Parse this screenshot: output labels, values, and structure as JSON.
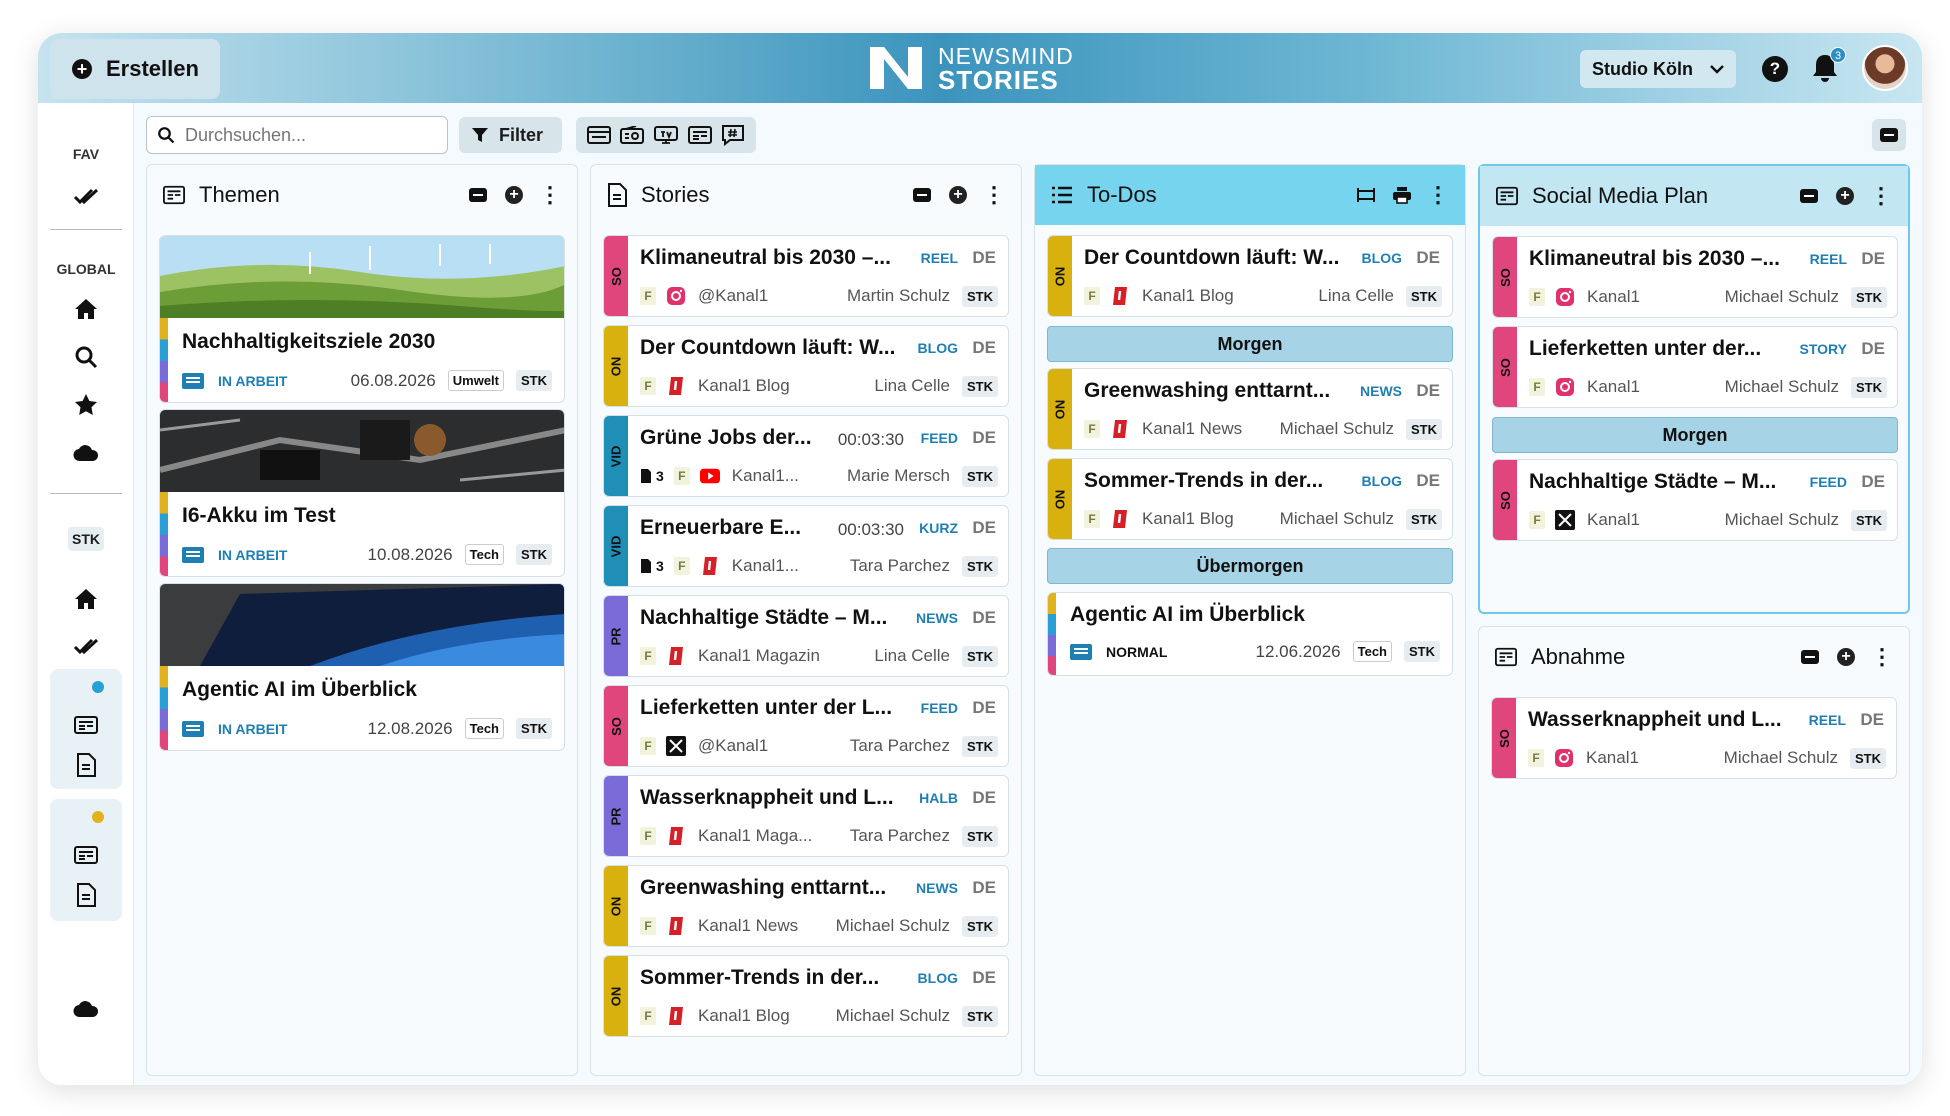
{
  "header": {
    "create_label": "Erstellen",
    "logo_line1": "NEWSMIND",
    "logo_line2": "STORIES",
    "studio": "Studio Köln",
    "notifications": "3"
  },
  "sidebar": {
    "fav": "FAV",
    "global": "GLOBAL",
    "stk": "STK",
    "dot_colors": [
      "#2a9fd6",
      "#e0b21b"
    ]
  },
  "toolbar": {
    "search_placeholder": "Durchsuchen...",
    "filter_label": "Filter"
  },
  "colors": {
    "SO": "#e0467c",
    "ON": "#d8b10f",
    "VID": "#1f8fb8",
    "PR": "#7b6bd8",
    "accent": "#1f7fb3",
    "todo_header": "#76d4ee"
  },
  "columns": {
    "themen": {
      "title": "Themen",
      "cards": [
        {
          "title": "Nachhaltigkeitsziele 2030",
          "status": "IN ARBEIT",
          "date": "06.08.2026",
          "tag": "Umwelt",
          "stk": "STK"
        },
        {
          "title": "I6-Akku im Test",
          "status": "IN ARBEIT",
          "date": "10.08.2026",
          "tag": "Tech",
          "stk": "STK"
        },
        {
          "title": "Agentic AI im Überblick",
          "status": "IN ARBEIT",
          "date": "12.08.2026",
          "tag": "Tech",
          "stk": "STK"
        }
      ]
    },
    "stories": {
      "title": "Stories",
      "items": [
        {
          "side": "SO",
          "title": "Klimaneutral bis 2030 –...",
          "type": "REEL",
          "lang": "DE",
          "f": "F",
          "channel_icon": "instagram-icon",
          "channel": "@Kanal1",
          "author": "Martin Schulz",
          "stk": "STK"
        },
        {
          "side": "ON",
          "title": "Der Countdown läuft: W...",
          "type": "BLOG",
          "lang": "DE",
          "f": "F",
          "channel_icon": "kanal1-icon",
          "channel": "Kanal1 Blog",
          "author": "Lina Celle",
          "stk": "STK"
        },
        {
          "side": "VID",
          "title": "Grüne Jobs der...",
          "duration": "00:03:30",
          "count": "3",
          "type": "FEED",
          "lang": "DE",
          "f": "F",
          "channel_icon": "youtube-icon",
          "channel": "Kanal1...",
          "author": "Marie Mersch",
          "stk": "STK"
        },
        {
          "side": "VID",
          "title": "Erneuerbare E...",
          "duration": "00:03:30",
          "count": "3",
          "type": "KURZ",
          "lang": "DE",
          "f": "F",
          "channel_icon": "kanal1-icon",
          "channel": "Kanal1...",
          "author": "Tara Parchez",
          "stk": "STK"
        },
        {
          "side": "PR",
          "title": "Nachhaltige Städte – M...",
          "type": "NEWS",
          "lang": "DE",
          "f": "F",
          "channel_icon": "kanal1-icon",
          "channel": "Kanal1 Magazin",
          "author": "Lina Celle",
          "stk": "STK"
        },
        {
          "side": "SO",
          "title": "Lieferketten unter der L...",
          "type": "FEED",
          "lang": "DE",
          "f": "F",
          "channel_icon": "x-icon",
          "channel": "@Kanal1",
          "author": "Tara Parchez",
          "stk": "STK"
        },
        {
          "side": "PR",
          "title": "Wasserknappheit und L...",
          "type": "HALB",
          "lang": "DE",
          "f": "F",
          "channel_icon": "kanal1-icon",
          "channel": "Kanal1 Maga...",
          "author": "Tara Parchez",
          "stk": "STK"
        },
        {
          "side": "ON",
          "title": "Greenwashing enttarnt...",
          "type": "NEWS",
          "lang": "DE",
          "f": "F",
          "channel_icon": "kanal1-icon",
          "channel": "Kanal1 News",
          "author": "Michael Schulz",
          "stk": "STK"
        },
        {
          "side": "ON",
          "title": "Sommer-Trends in der...",
          "type": "BLOG",
          "lang": "DE",
          "f": "F",
          "channel_icon": "kanal1-icon",
          "channel": "Kanal1 Blog",
          "author": "Michael Schulz",
          "stk": "STK"
        }
      ]
    },
    "todos": {
      "title": "To-Dos",
      "items": [
        {
          "side": "ON",
          "title": "Der Countdown läuft: W...",
          "type": "BLOG",
          "lang": "DE",
          "f": "F",
          "channel_icon": "kanal1-icon",
          "channel": "Kanal1 Blog",
          "author": "Lina Celle",
          "stk": "STK"
        },
        {
          "side": "ON",
          "title": "Greenwashing enttarnt...",
          "type": "NEWS",
          "lang": "DE",
          "f": "F",
          "channel_icon": "kanal1-icon",
          "channel": "Kanal1 News",
          "author": "Michael Schulz",
          "stk": "STK"
        },
        {
          "side": "ON",
          "title": "Sommer-Trends in der...",
          "type": "BLOG",
          "lang": "DE",
          "f": "F",
          "channel_icon": "kanal1-icon",
          "channel": "Kanal1 Blog",
          "author": "Michael Schulz",
          "stk": "STK"
        }
      ],
      "group_morgen": "Morgen",
      "group_uebermorgen": "Übermorgen",
      "topic": {
        "title": "Agentic AI im Überblick",
        "status": "NORMAL",
        "date": "12.06.2026",
        "tag": "Tech",
        "stk": "STK"
      }
    },
    "social": {
      "title": "Social Media Plan",
      "items": [
        {
          "side": "SO",
          "title": "Klimaneutral bis 2030 –...",
          "type": "REEL",
          "lang": "DE",
          "f": "F",
          "channel_icon": "instagram-icon",
          "channel": "Kanal1",
          "author": "Michael Schulz",
          "stk": "STK"
        },
        {
          "side": "SO",
          "title": "Lieferketten unter der...",
          "type": "STORY",
          "lang": "DE",
          "f": "F",
          "channel_icon": "instagram-icon",
          "channel": "Kanal1",
          "author": "Michael Schulz",
          "stk": "STK"
        },
        {
          "side": "SO",
          "title": "Nachhaltige Städte – M...",
          "type": "FEED",
          "lang": "DE",
          "f": "F",
          "channel_icon": "x-icon",
          "channel": "Kanal1",
          "author": "Michael Schulz",
          "stk": "STK"
        }
      ],
      "group_morgen": "Morgen"
    },
    "abnahme": {
      "title": "Abnahme",
      "items": [
        {
          "side": "SO",
          "title": "Wasserknappheit und L...",
          "type": "REEL",
          "lang": "DE",
          "f": "F",
          "channel_icon": "instagram-icon",
          "channel": "Kanal1",
          "author": "Michael Schulz",
          "stk": "STK"
        }
      ]
    }
  }
}
